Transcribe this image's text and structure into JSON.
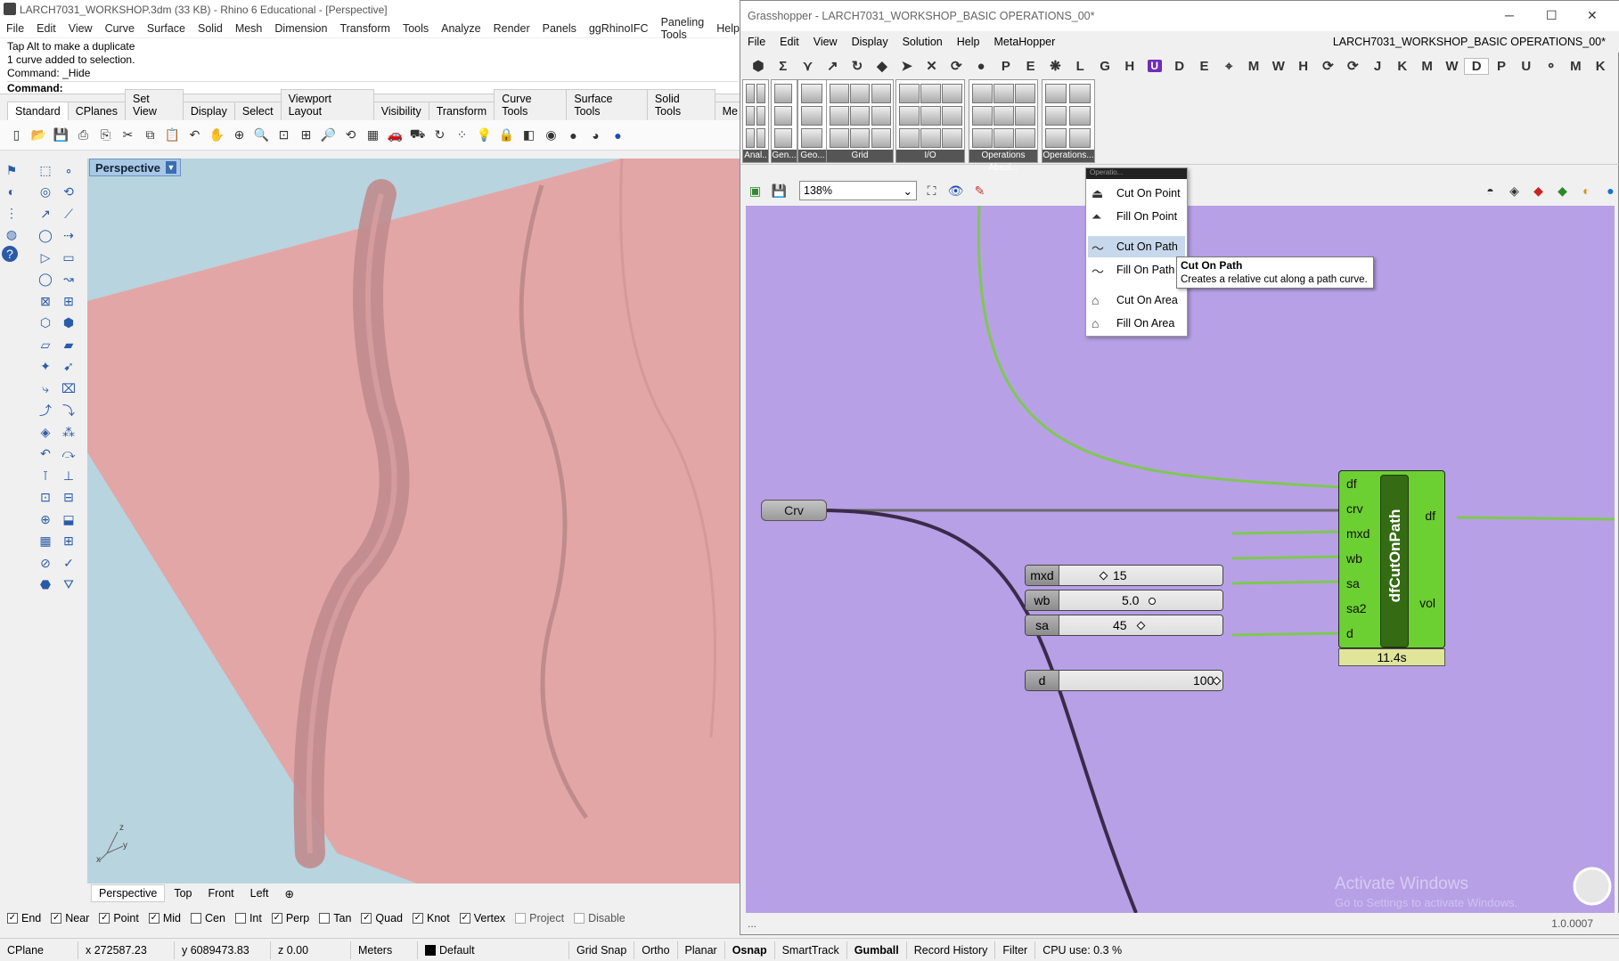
{
  "rhino": {
    "title": "LARCH7031_WORKSHOP.3dm (33 KB) - Rhino 6 Educational - [Perspective]",
    "menu": [
      "File",
      "Edit",
      "View",
      "Curve",
      "Surface",
      "Solid",
      "Mesh",
      "Dimension",
      "Transform",
      "Tools",
      "Analyze",
      "Render",
      "Panels",
      "ggRhinoIFC",
      "Paneling Tools",
      "Help"
    ],
    "command_history": [
      "Tap Alt to make a duplicate",
      "1 curve added to selection.",
      "Command: _Hide"
    ],
    "command_prompt": "Command:",
    "toolbar_tabs": [
      "Standard",
      "CPlanes",
      "Set View",
      "Display",
      "Select",
      "Viewport Layout",
      "Visibility",
      "Transform",
      "Curve Tools",
      "Surface Tools",
      "Solid Tools",
      "Me"
    ],
    "active_tab": "Standard",
    "viewport_label": "Perspective",
    "viewport_tabs": [
      "Perspective",
      "Top",
      "Front",
      "Left"
    ],
    "axis": {
      "x": "x",
      "y": "y",
      "z": "z"
    },
    "osnaps": [
      {
        "label": "End",
        "checked": true
      },
      {
        "label": "Near",
        "checked": true
      },
      {
        "label": "Point",
        "checked": true
      },
      {
        "label": "Mid",
        "checked": true
      },
      {
        "label": "Cen",
        "checked": false
      },
      {
        "label": "Int",
        "checked": false
      },
      {
        "label": "Perp",
        "checked": true
      },
      {
        "label": "Tan",
        "checked": false
      },
      {
        "label": "Quad",
        "checked": true
      },
      {
        "label": "Knot",
        "checked": true
      },
      {
        "label": "Vertex",
        "checked": true
      },
      {
        "label": "Project",
        "checked": false,
        "disabled": true
      },
      {
        "label": "Disable",
        "checked": false,
        "disabled": true
      }
    ],
    "colors": {
      "terrain": "#e0a5a5",
      "sky": "#b8d4df"
    }
  },
  "status_bar": {
    "cplane": "CPlane",
    "x": "x 272587.23",
    "y": "y 6089473.83",
    "z": "z 0.00",
    "units": "Meters",
    "layer": "Default",
    "toggles": [
      "Grid Snap",
      "Ortho",
      "Planar",
      "Osnap",
      "SmartTrack",
      "Gumball",
      "Record History",
      "Filter"
    ],
    "cpu": "CPU use: 0.3 %"
  },
  "grasshopper": {
    "title": "Grasshopper - LARCH7031_WORKSHOP_BASIC OPERATIONS_00*",
    "menu": [
      "File",
      "Edit",
      "View",
      "Display",
      "Solution",
      "Help",
      "MetaHopper"
    ],
    "document_name": "LARCH7031_WORKSHOP_BASIC OPERATIONS_00*",
    "categories": [
      "⬢",
      "Σ",
      "⋎",
      "↗",
      "↻",
      "◆",
      "➤",
      "✕",
      "⟳",
      "●",
      "P",
      "E",
      "❋",
      "L",
      "G",
      "H",
      "U",
      "D",
      "E",
      "⌖",
      "M",
      "W",
      "H",
      "⟳",
      "⟳",
      "J",
      "K",
      "M",
      "W",
      "D",
      "P",
      "U",
      "⚬",
      "M",
      "K"
    ],
    "panel_captions": [
      "Anal..",
      "Gen...",
      "Geo...",
      "Grid",
      "I/O",
      "Operations Absol...",
      "Operations..."
    ],
    "zoom": "138%",
    "dropdown_header": "Operatio...",
    "dropdown_items": [
      "Cut On Point",
      "Fill On Point",
      "Cut On Path",
      "Fill On Path",
      "Cut On Area",
      "Fill On Area"
    ],
    "selected_item": "Cut On Path",
    "tooltip": {
      "title": "Cut On Path",
      "body": "Creates a relative cut along a path curve."
    },
    "param_crv": "Crv",
    "sliders": [
      {
        "name": "mxd",
        "value": "15",
        "fraction": 0.15
      },
      {
        "name": "wb",
        "value": "5.0",
        "fraction": 0.5
      },
      {
        "name": "sa",
        "value": "45",
        "fraction": 0.45
      },
      {
        "name": "d",
        "value": "100",
        "fraction": 1.0
      }
    ],
    "component": {
      "name": "dfCutOnPath",
      "inputs": [
        "df",
        "crv",
        "mxd",
        "wb",
        "sa",
        "sa2",
        "d"
      ],
      "outputs": [
        "df",
        "vol"
      ],
      "time": "11.4s"
    },
    "footer": "...",
    "version": "1.0.0007",
    "watermark_title": "Activate Windows",
    "watermark_sub": "Go to Settings to activate Windows.",
    "colors": {
      "canvas": "#b7a0e6",
      "component": "#6ccf32",
      "wire_green": "#7ec850",
      "wire_dark": "#3b2a4a"
    }
  }
}
